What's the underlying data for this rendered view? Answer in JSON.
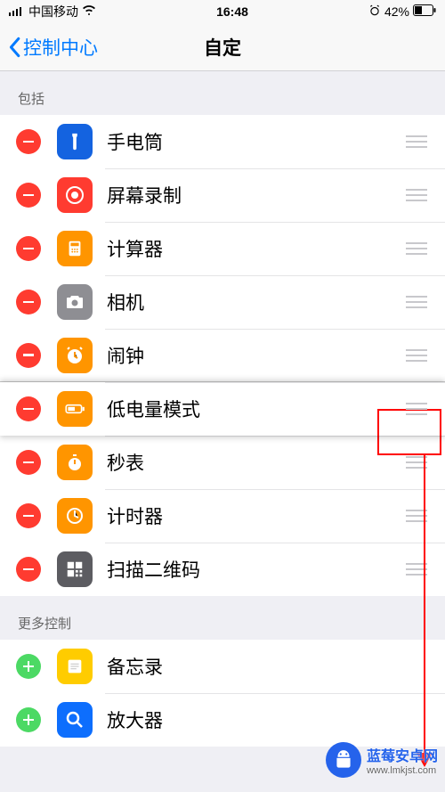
{
  "status": {
    "carrier": "中国移动",
    "time": "16:48",
    "battery_percent": "42%"
  },
  "nav": {
    "back_label": "控制中心",
    "title": "自定"
  },
  "sections": {
    "include_header": "包括",
    "more_header": "更多控制"
  },
  "include": [
    {
      "id": "flashlight",
      "label": "手电筒",
      "icon_bg": "#1463E0",
      "icon": "flashlight"
    },
    {
      "id": "screenrec",
      "label": "屏幕录制",
      "icon_bg": "#FF3B30",
      "icon": "record"
    },
    {
      "id": "calculator",
      "label": "计算器",
      "icon_bg": "#FF9500",
      "icon": "calculator"
    },
    {
      "id": "camera",
      "label": "相机",
      "icon_bg": "#8E8E93",
      "icon": "camera"
    },
    {
      "id": "alarm",
      "label": "闹钟",
      "icon_bg": "#FF9500",
      "icon": "clock"
    },
    {
      "id": "lowpower",
      "label": "低电量模式",
      "icon_bg": "#FF9500",
      "icon": "battery"
    },
    {
      "id": "stopwatch",
      "label": "秒表",
      "icon_bg": "#FF9500",
      "icon": "stopwatch"
    },
    {
      "id": "timer",
      "label": "计时器",
      "icon_bg": "#FF9500",
      "icon": "timer"
    },
    {
      "id": "qrscan",
      "label": "扫描二维码",
      "icon_bg": "#5C5C61",
      "icon": "qr"
    }
  ],
  "more": [
    {
      "id": "notes",
      "label": "备忘录",
      "icon_bg": "#FFCC00",
      "icon": "notes"
    },
    {
      "id": "magnifier",
      "label": "放大器",
      "icon_bg": "#0D6EFD",
      "icon": "magnifier"
    }
  ],
  "watermark": {
    "title": "蓝莓安卓网",
    "url": "www.lmkjst.com"
  },
  "icons": {
    "flashlight": "<svg viewBox='0 0 24 24' width='22' height='22'><path fill='#fff' d='M9 2h6v3l-1 2v13a2 2 0 0 1-4 0V7L9 5z'/></svg>",
    "record": "<svg viewBox='0 0 24 24' width='24' height='24'><circle cx='12' cy='12' r='9' fill='none' stroke='#fff' stroke-width='2'/><circle cx='12' cy='12' r='4' fill='#fff'/></svg>",
    "calculator": "<svg viewBox='0 0 24 24' width='22' height='22'><rect x='5' y='3' width='14' height='18' rx='2' fill='#fff'/><rect x='7' y='5' width='10' height='4' fill='#FF9500'/><circle cx='9' cy='13' r='1' fill='#FF9500'/><circle cx='12' cy='13' r='1' fill='#FF9500'/><circle cx='15' cy='13' r='1' fill='#FF9500'/><circle cx='9' cy='16' r='1' fill='#FF9500'/><circle cx='12' cy='16' r='1' fill='#FF9500'/><circle cx='15' cy='16' r='1' fill='#FF9500'/></svg>",
    "camera": "<svg viewBox='0 0 24 24' width='24' height='24'><path fill='#fff' d='M4 7h3l1-2h8l1 2h3a1 1 0 0 1 1 1v10a1 1 0 0 1-1 1H4a1 1 0 0 1-1-1V8a1 1 0 0 1 1-1z'/><circle cx='12' cy='13' r='3.5' fill='#8E8E93'/></svg>",
    "clock": "<svg viewBox='0 0 24 24' width='24' height='24'><circle cx='12' cy='13' r='8' fill='#fff'/><path stroke='#FF9500' stroke-width='2' d='M12 8v5l3 2'/><path stroke='#fff' stroke-width='2' d='M6 3l-2 2M18 3l2 2'/></svg>",
    "battery": "<svg viewBox='0 0 24 24' width='26' height='26'><rect x='3' y='8' width='16' height='8' rx='2' fill='none' stroke='#fff' stroke-width='1.5'/><rect x='5' y='10' width='7' height='4' fill='#fff'/><rect x='20' y='10' width='2' height='4' fill='#fff'/></svg>",
    "stopwatch": "<svg viewBox='0 0 24 24' width='24' height='24'><circle cx='12' cy='14' r='7' fill='#fff'/><rect x='10' y='3' width='4' height='2' fill='#fff'/><path stroke='#FF9500' stroke-width='2' d='M12 9v5'/></svg>",
    "timer": "<svg viewBox='0 0 24 24' width='24' height='24'><circle cx='12' cy='12' r='8' fill='none' stroke='#fff' stroke-width='2'/><path stroke='#fff' stroke-width='2' d='M12 6v6l4 2'/></svg>",
    "qr": "<svg viewBox='0 0 24 24' width='22' height='22'><rect x='3' y='3' width='8' height='8' fill='#fff'/><rect x='13' y='3' width='8' height='8' fill='#fff'/><rect x='3' y='13' width='8' height='8' fill='#fff'/><rect x='13' y='13' width='3' height='3' fill='#fff'/><rect x='18' y='13' width='3' height='3' fill='#fff'/><rect x='13' y='18' width='3' height='3' fill='#fff'/><rect x='18' y='18' width='3' height='3' fill='#fff'/></svg>",
    "notes": "<svg viewBox='0 0 24 24' width='22' height='22'><rect x='4' y='4' width='16' height='16' rx='2' fill='#fff'/><line x1='7' y1='9' x2='17' y2='9' stroke='#BBB' stroke-width='1'/><line x1='7' y1='12' x2='17' y2='12' stroke='#BBB' stroke-width='1'/><line x1='7' y1='15' x2='14' y2='15' stroke='#BBB' stroke-width='1'/></svg>",
    "magnifier": "<svg viewBox='0 0 24 24' width='24' height='24'><circle cx='10' cy='10' r='6' fill='none' stroke='#fff' stroke-width='2.5'/><line x1='15' y1='15' x2='20' y2='20' stroke='#fff' stroke-width='2.5'/></svg>"
  }
}
